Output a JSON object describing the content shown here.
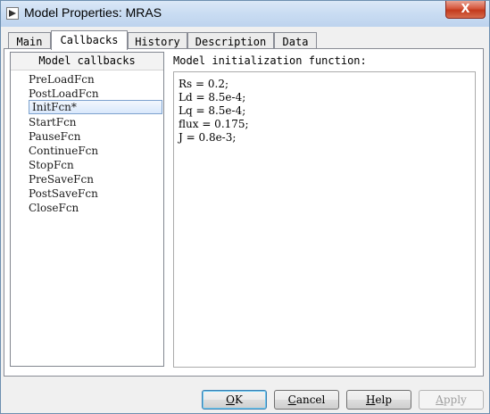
{
  "window": {
    "title": "Model Properties: MRAS",
    "close_label": "X"
  },
  "tabs": [
    "Main",
    "Callbacks",
    "History",
    "Description",
    "Data"
  ],
  "active_tab": "Callbacks",
  "callbacks": {
    "header": "Model callbacks",
    "items": [
      "PreLoadFcn",
      "PostLoadFcn",
      "InitFcn*",
      "StartFcn",
      "PauseFcn",
      "ContinueFcn",
      "StopFcn",
      "PreSaveFcn",
      "PostSaveFcn",
      "CloseFcn"
    ],
    "selected": "InitFcn*"
  },
  "editor": {
    "label": "Model initialization function:",
    "lines": [
      "Rs = 0.2;",
      "Ld = 8.5e-4;",
      "Lq = 8.5e-4;",
      "flux = 0.175;",
      "J = 0.8e-3;"
    ]
  },
  "buttons": {
    "ok": {
      "mnemonic": "O",
      "rest": "K"
    },
    "cancel": {
      "mnemonic": "C",
      "rest": "ancel"
    },
    "help": {
      "mnemonic": "H",
      "rest": "elp"
    },
    "apply": {
      "mnemonic": "A",
      "rest": "pply",
      "enabled": false
    }
  }
}
